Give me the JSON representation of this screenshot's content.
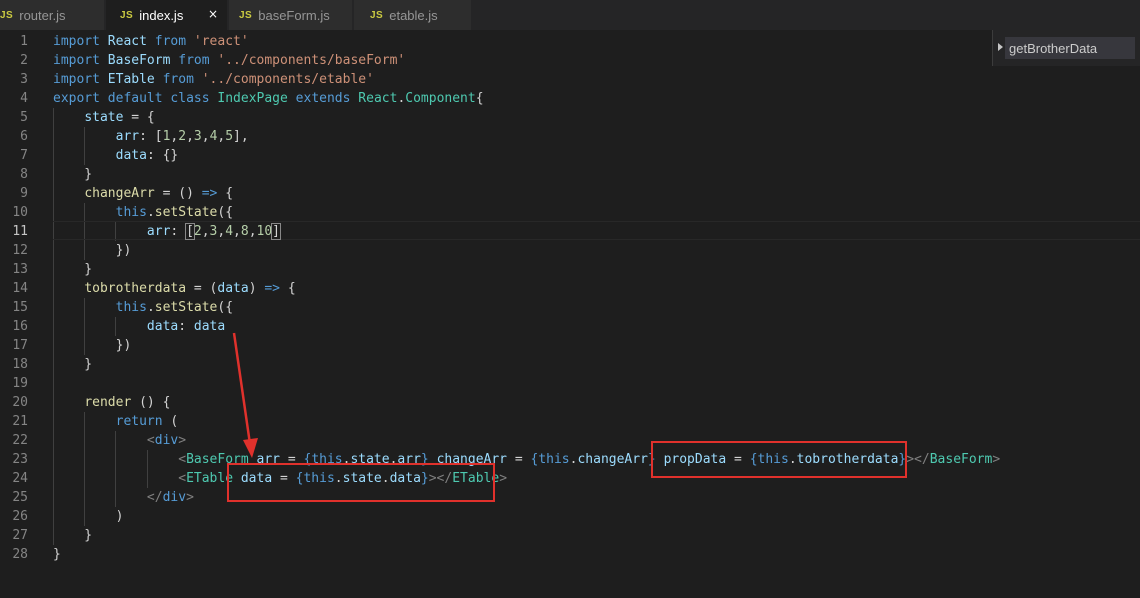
{
  "tabs": [
    {
      "icon": "JS",
      "label": "router.js"
    },
    {
      "icon": "JS",
      "label": "index.js",
      "close": "×"
    },
    {
      "icon": "JS",
      "label": "baseForm.js"
    },
    {
      "icon": "JS",
      "label": "etable.js"
    }
  ],
  "outline": {
    "item": "getBrotherData"
  },
  "editor": {
    "line_numbers": [
      "1",
      "2",
      "3",
      "4",
      "5",
      "6",
      "7",
      "8",
      "9",
      "10",
      "11",
      "12",
      "13",
      "14",
      "15",
      "16",
      "17",
      "18",
      "19",
      "20",
      "21",
      "22",
      "23",
      "24",
      "25",
      "26",
      "27",
      "28"
    ],
    "current_line": 11,
    "lines": [
      [
        [
          "kw",
          "import"
        ],
        [
          "p",
          " "
        ],
        [
          "var",
          "React"
        ],
        [
          "p",
          " "
        ],
        [
          "kw",
          "from"
        ],
        [
          "p",
          " "
        ],
        [
          "str",
          "'react'"
        ]
      ],
      [
        [
          "kw",
          "import"
        ],
        [
          "p",
          " "
        ],
        [
          "var",
          "BaseForm"
        ],
        [
          "p",
          " "
        ],
        [
          "kw",
          "from"
        ],
        [
          "p",
          " "
        ],
        [
          "str",
          "'../components/baseForm'"
        ]
      ],
      [
        [
          "kw",
          "import"
        ],
        [
          "p",
          " "
        ],
        [
          "var",
          "ETable"
        ],
        [
          "p",
          " "
        ],
        [
          "kw",
          "from"
        ],
        [
          "p",
          " "
        ],
        [
          "str",
          "'../components/etable'"
        ]
      ],
      [
        [
          "kw",
          "export"
        ],
        [
          "p",
          " "
        ],
        [
          "kw",
          "default"
        ],
        [
          "p",
          " "
        ],
        [
          "kw",
          "class"
        ],
        [
          "p",
          " "
        ],
        [
          "cls",
          "IndexPage"
        ],
        [
          "p",
          " "
        ],
        [
          "kw",
          "extends"
        ],
        [
          "p",
          " "
        ],
        [
          "cls",
          "React"
        ],
        [
          "p",
          "."
        ],
        [
          "cls",
          "Component"
        ],
        [
          "p",
          "{"
        ]
      ],
      [
        [
          "p",
          "    "
        ],
        [
          "var",
          "state"
        ],
        [
          "p",
          " = {"
        ]
      ],
      [
        [
          "p",
          "        "
        ],
        [
          "var",
          "arr"
        ],
        [
          "p",
          ": ["
        ],
        [
          "num",
          "1"
        ],
        [
          "p",
          ","
        ],
        [
          "num",
          "2"
        ],
        [
          "p",
          ","
        ],
        [
          "num",
          "3"
        ],
        [
          "p",
          ","
        ],
        [
          "num",
          "4"
        ],
        [
          "p",
          ","
        ],
        [
          "num",
          "5"
        ],
        [
          "p",
          "],"
        ]
      ],
      [
        [
          "p",
          "        "
        ],
        [
          "var",
          "data"
        ],
        [
          "p",
          ": {}"
        ]
      ],
      [
        [
          "p",
          "    }"
        ]
      ],
      [
        [
          "p",
          "    "
        ],
        [
          "fn",
          "changeArr"
        ],
        [
          "p",
          " = () "
        ],
        [
          "kw",
          "=>"
        ],
        [
          "p",
          " {"
        ]
      ],
      [
        [
          "p",
          "        "
        ],
        [
          "kw",
          "this"
        ],
        [
          "p",
          "."
        ],
        [
          "fn",
          "setState"
        ],
        [
          "p",
          "({"
        ]
      ],
      [
        [
          "p",
          "            "
        ],
        [
          "var",
          "arr"
        ],
        [
          "p",
          ": "
        ],
        [
          "bkt",
          "["
        ],
        [
          "num",
          "2"
        ],
        [
          "p",
          ","
        ],
        [
          "num",
          "3"
        ],
        [
          "p",
          ","
        ],
        [
          "num",
          "4"
        ],
        [
          "p",
          ","
        ],
        [
          "num",
          "8"
        ],
        [
          "p",
          ","
        ],
        [
          "num",
          "10"
        ],
        [
          "bkt",
          "]"
        ]
      ],
      [
        [
          "p",
          "        })"
        ]
      ],
      [
        [
          "p",
          "    }"
        ]
      ],
      [
        [
          "p",
          "    "
        ],
        [
          "fn",
          "tobrotherdata"
        ],
        [
          "p",
          " = ("
        ],
        [
          "var",
          "data"
        ],
        [
          "p",
          ") "
        ],
        [
          "kw",
          "=>"
        ],
        [
          "p",
          " {"
        ]
      ],
      [
        [
          "p",
          "        "
        ],
        [
          "kw",
          "this"
        ],
        [
          "p",
          "."
        ],
        [
          "fn",
          "setState"
        ],
        [
          "p",
          "({"
        ]
      ],
      [
        [
          "p",
          "            "
        ],
        [
          "var",
          "data"
        ],
        [
          "p",
          ": "
        ],
        [
          "var",
          "data"
        ]
      ],
      [
        [
          "p",
          "        })"
        ]
      ],
      [
        [
          "p",
          "    }"
        ]
      ],
      [
        [
          "p",
          ""
        ]
      ],
      [
        [
          "p",
          "    "
        ],
        [
          "fn",
          "render"
        ],
        [
          "p",
          " () {"
        ]
      ],
      [
        [
          "p",
          "        "
        ],
        [
          "kw",
          "return"
        ],
        [
          "p",
          " ("
        ]
      ],
      [
        [
          "p",
          "            "
        ],
        [
          "tagp",
          "<"
        ],
        [
          "kw",
          "div"
        ],
        [
          "tagp",
          ">"
        ]
      ],
      [
        [
          "p",
          "                "
        ],
        [
          "tagp",
          "<"
        ],
        [
          "tag",
          "BaseForm"
        ],
        [
          "p",
          " "
        ],
        [
          "var",
          "arr"
        ],
        [
          "p",
          " = "
        ],
        [
          "kw",
          "{"
        ],
        [
          "kw",
          "this"
        ],
        [
          "p",
          "."
        ],
        [
          "var",
          "state"
        ],
        [
          "p",
          "."
        ],
        [
          "var",
          "arr"
        ],
        [
          "kw",
          "}"
        ],
        [
          "p",
          " "
        ],
        [
          "var",
          "changeArr"
        ],
        [
          "p",
          " = "
        ],
        [
          "kw",
          "{"
        ],
        [
          "kw",
          "this"
        ],
        [
          "p",
          "."
        ],
        [
          "var",
          "changeArr"
        ],
        [
          "kw",
          "}"
        ],
        [
          "p",
          " "
        ],
        [
          "var",
          "propData"
        ],
        [
          "p",
          " = "
        ],
        [
          "kw",
          "{"
        ],
        [
          "kw",
          "this"
        ],
        [
          "p",
          "."
        ],
        [
          "var",
          "tobrotherdata"
        ],
        [
          "kw",
          "}"
        ],
        [
          "tagp",
          "></"
        ],
        [
          "tag",
          "BaseForm"
        ],
        [
          "tagp",
          ">"
        ]
      ],
      [
        [
          "p",
          "                "
        ],
        [
          "tagp",
          "<"
        ],
        [
          "tag",
          "ETable"
        ],
        [
          "p",
          " "
        ],
        [
          "var",
          "data"
        ],
        [
          "p",
          " = "
        ],
        [
          "kw",
          "{"
        ],
        [
          "kw",
          "this"
        ],
        [
          "p",
          "."
        ],
        [
          "var",
          "state"
        ],
        [
          "p",
          "."
        ],
        [
          "var",
          "data"
        ],
        [
          "kw",
          "}"
        ],
        [
          "tagp",
          "></"
        ],
        [
          "tag",
          "ETable"
        ],
        [
          "tagp",
          ">"
        ]
      ],
      [
        [
          "p",
          "            "
        ],
        [
          "tagp",
          "</"
        ],
        [
          "kw",
          "div"
        ],
        [
          "tagp",
          ">"
        ]
      ],
      [
        [
          "p",
          "        )"
        ]
      ],
      [
        [
          "p",
          "    }"
        ]
      ],
      [
        [
          "p",
          "}"
        ]
      ]
    ]
  }
}
